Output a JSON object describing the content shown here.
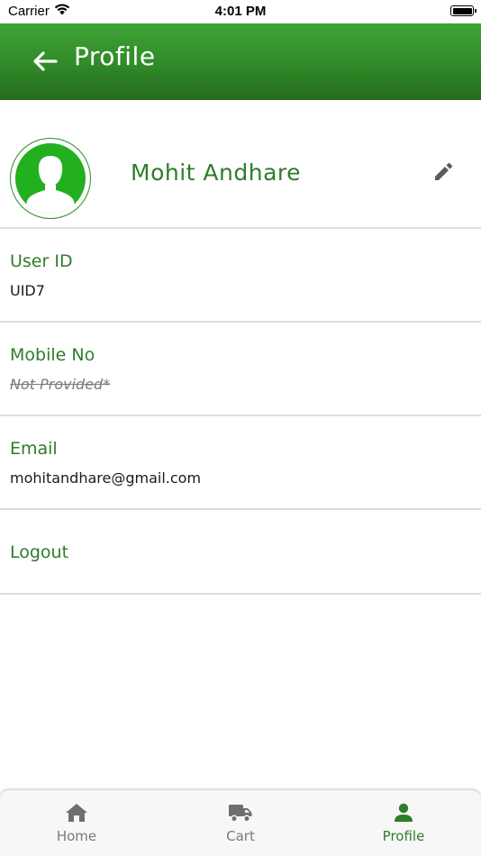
{
  "status_bar": {
    "carrier": "Carrier",
    "time": "4:01 PM"
  },
  "app_bar": {
    "title": "Profile",
    "back_icon": "arrow-left-icon",
    "color": "#2f8a27"
  },
  "profile": {
    "name": "Mohit Andhare",
    "avatar_icon": "user-silhouette-icon",
    "edit_icon": "pencil-icon"
  },
  "fields": [
    {
      "label": "User ID",
      "value": "UID7"
    },
    {
      "label": "Mobile No",
      "value": "Not Provided*"
    },
    {
      "label": "Email",
      "value": "mohitandhare@gmail.com"
    }
  ],
  "logout_label": "Logout",
  "tab_bar": {
    "items": [
      {
        "label": "Home",
        "icon": "home-icon",
        "active": false
      },
      {
        "label": "Cart",
        "icon": "truck-icon",
        "active": false
      },
      {
        "label": "Profile",
        "icon": "user-icon",
        "active": true
      }
    ]
  },
  "colors": {
    "accent": "#2e7d2a",
    "inactive": "#7a7a7a",
    "avatar": "#22b01f"
  }
}
